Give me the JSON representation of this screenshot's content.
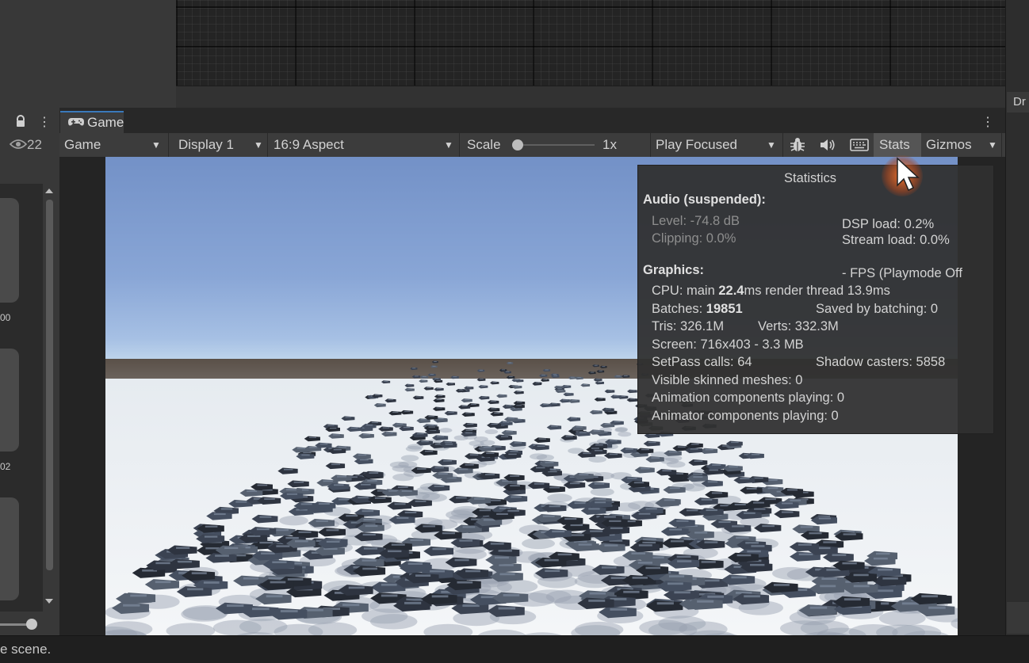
{
  "right_panel": {
    "tab_label": "Dr"
  },
  "hierarchy": {
    "visible_count": "22",
    "item_captions": [
      "00",
      "02"
    ],
    "icons": [
      "lock-icon",
      "kebab-menu-icon",
      "eye-icon"
    ]
  },
  "game_tab": {
    "label": "Game",
    "icon": "gamepad-icon"
  },
  "toolbar": {
    "mode_select": "Game",
    "display_select": "Display 1",
    "aspect_select": "16:9 Aspect",
    "scale_label": "Scale",
    "scale_value": "1x",
    "scale_fraction": 0,
    "play_mode_select": "Play Focused",
    "icons": [
      "bug-icon",
      "speaker-icon",
      "keyboard-icon"
    ],
    "stats_label": "Stats",
    "gizmos_label": "Gizmos",
    "stats_active": true
  },
  "statistics": {
    "title": "Statistics",
    "audio_heading": "Audio (suspended):",
    "level": "Level: -74.8 dB",
    "clipping": "Clipping: 0.0%",
    "dsp_load": "DSP load: 0.2%",
    "stream_load": "Stream load: 0.0%",
    "graphics_heading": "Graphics:",
    "fps": "- FPS (Playmode Off",
    "cpu_prefix": "CPU: main ",
    "cpu_main": "22.4",
    "cpu_suffix": "ms  render thread 13.9ms",
    "batches_prefix": "Batches: ",
    "batches_value": "19851",
    "saved_by_batching": "Saved by batching: 0",
    "tris": "Tris: 326.1M",
    "verts": "Verts: 332.3M",
    "screen": "Screen: 716x403 - 3.3 MB",
    "setpass": "SetPass calls: 64",
    "shadow_casters": "Shadow casters: 5858",
    "skinned_meshes": "Visible skinned meshes: 0",
    "animation_components": "Animation components playing: 0",
    "animator_components": "Animator components playing: 0"
  },
  "status_bar": {
    "message": "e scene."
  },
  "colors": {
    "panel": "#383838",
    "toolbar": "#3c3c3c",
    "tab_accent": "#3a79bb",
    "cursor_highlight": "#ff7328"
  }
}
